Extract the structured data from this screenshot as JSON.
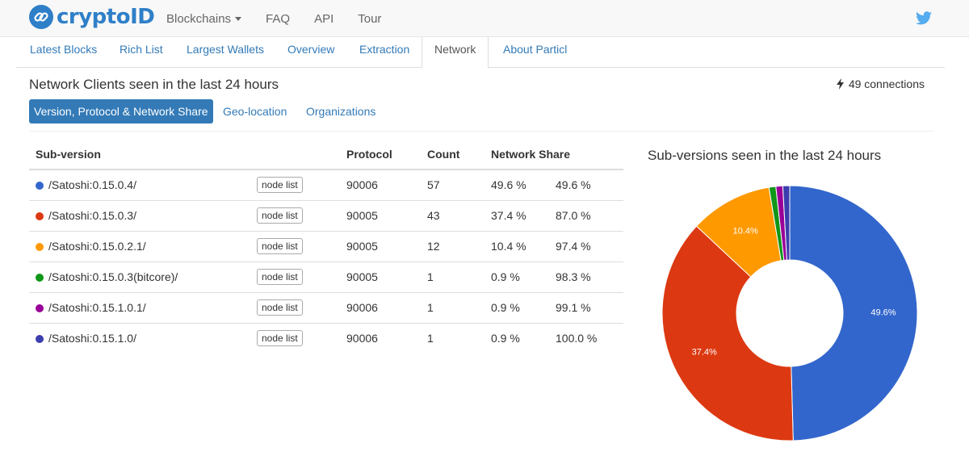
{
  "topbar": {
    "brand": "cryptoID",
    "nav": [
      {
        "label": "Blockchains",
        "dropdown": true
      },
      {
        "label": "FAQ"
      },
      {
        "label": "API"
      },
      {
        "label": "Tour"
      }
    ]
  },
  "tabs": [
    {
      "label": "Latest Blocks"
    },
    {
      "label": "Rich List"
    },
    {
      "label": "Largest Wallets"
    },
    {
      "label": "Overview"
    },
    {
      "label": "Extraction"
    },
    {
      "label": "Network",
      "active": true
    },
    {
      "label": "About Particl"
    }
  ],
  "page": {
    "heading": "Network Clients seen in the last 24 hours",
    "connections": "49 connections"
  },
  "pills": [
    {
      "label": "Version, Protocol & Network Share",
      "active": true
    },
    {
      "label": "Geo-location"
    },
    {
      "label": "Organizations"
    }
  ],
  "table": {
    "headers": {
      "subversion": "Sub-version",
      "protocol": "Protocol",
      "count": "Count",
      "share": "Network Share"
    },
    "node_list_label": "node list",
    "rows": [
      {
        "name": "/Satoshi:0.15.0.4/",
        "color": "#3366cc",
        "protocol": "90006",
        "count": "57",
        "share": "49.6 %",
        "cumulative": "49.6 %"
      },
      {
        "name": "/Satoshi:0.15.0.3/",
        "color": "#dc3912",
        "protocol": "90005",
        "count": "43",
        "share": "37.4 %",
        "cumulative": "87.0 %"
      },
      {
        "name": "/Satoshi:0.15.0.2.1/",
        "color": "#ff9900",
        "protocol": "90005",
        "count": "12",
        "share": "10.4 %",
        "cumulative": "97.4 %"
      },
      {
        "name": "/Satoshi:0.15.0.3(bitcore)/",
        "color": "#109618",
        "protocol": "90005",
        "count": "1",
        "share": "0.9 %",
        "cumulative": "98.3 %"
      },
      {
        "name": "/Satoshi:0.15.1.0.1/",
        "color": "#990099",
        "protocol": "90006",
        "count": "1",
        "share": "0.9 %",
        "cumulative": "99.1 %"
      },
      {
        "name": "/Satoshi:0.15.1.0/",
        "color": "#3b3eac",
        "protocol": "90006",
        "count": "1",
        "share": "0.9 %",
        "cumulative": "100.0 %"
      }
    ]
  },
  "chart_title": "Sub-versions seen in the last 24 hours",
  "chart_data": {
    "type": "pie",
    "title": "Sub-versions seen in the last 24 hours",
    "donut": true,
    "labels": [
      "/Satoshi:0.15.0.4/",
      "/Satoshi:0.15.0.3/",
      "/Satoshi:0.15.0.2.1/",
      "/Satoshi:0.15.0.3(bitcore)/",
      "/Satoshi:0.15.1.0.1/",
      "/Satoshi:0.15.1.0/"
    ],
    "values": [
      57,
      43,
      12,
      1,
      1,
      1
    ],
    "colors": [
      "#3366cc",
      "#dc3912",
      "#ff9900",
      "#109618",
      "#990099",
      "#3b3eac"
    ],
    "slice_labels": [
      "49.6%",
      "37.4%",
      "10.4%",
      "",
      "",
      ""
    ]
  }
}
